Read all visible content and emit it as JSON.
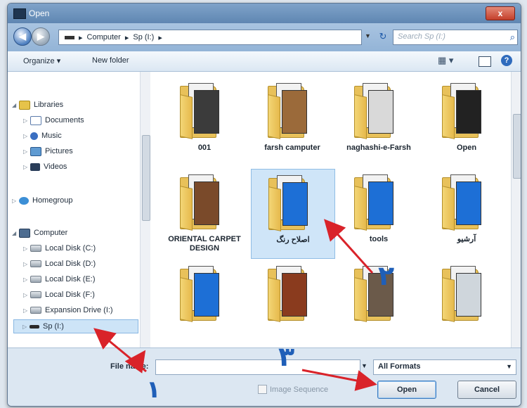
{
  "window": {
    "title": "Open",
    "close_glyph": "x"
  },
  "address": {
    "crumbs": [
      "Computer",
      "Sp (I:)"
    ],
    "separator": "▸",
    "search_placeholder": "Search Sp (I:)"
  },
  "toolbar": {
    "organize": "Organize ▾",
    "new_folder": "New folder"
  },
  "nav": {
    "libraries": "Libraries",
    "documents": "Documents",
    "music": "Music",
    "pictures": "Pictures",
    "videos": "Videos",
    "homegroup": "Homegroup",
    "computer": "Computer",
    "disk_c": "Local Disk (C:)",
    "disk_d": "Local Disk (D:)",
    "disk_e": "Local Disk (E:)",
    "disk_f": "Local Disk (F:)",
    "expansion": "Expansion Drive (I:)",
    "sp": "Sp (I:)"
  },
  "folders": [
    {
      "label": "001",
      "page_color": "#3b3b3b"
    },
    {
      "label": "farsh camputer",
      "page_color": "#9b6a3a"
    },
    {
      "label": "naghashi-e-Farsh",
      "page_color": "#d9d9d9"
    },
    {
      "label": "Open",
      "page_color": "#222222"
    },
    {
      "label": "ORIENTAL CARPET DESIGN",
      "page_color": "#7a4a2a"
    },
    {
      "label": "اصلاح رنگ",
      "page_color": "#1d6fd6",
      "selected": true
    },
    {
      "label": "tools",
      "page_color": "#1d6fd6"
    },
    {
      "label": "آرشیو",
      "page_color": "#1d6fd6"
    },
    {
      "label": "",
      "page_color": "#1d6fd6"
    },
    {
      "label": "",
      "page_color": "#8a3b1e"
    },
    {
      "label": "",
      "page_color": "#6b5a4a"
    },
    {
      "label": "",
      "page_color": "#cfd6dc"
    }
  ],
  "bottom": {
    "file_name_label": "File name:",
    "file_name_value": "",
    "format": "All Formats",
    "image_sequence": "Image Sequence",
    "open": "Open",
    "cancel": "Cancel"
  },
  "annotations": {
    "n1": "۱",
    "n2": "۲",
    "n3": "۳",
    "arrow_color": "#d9232a",
    "digit_color": "#1f5fb8"
  }
}
